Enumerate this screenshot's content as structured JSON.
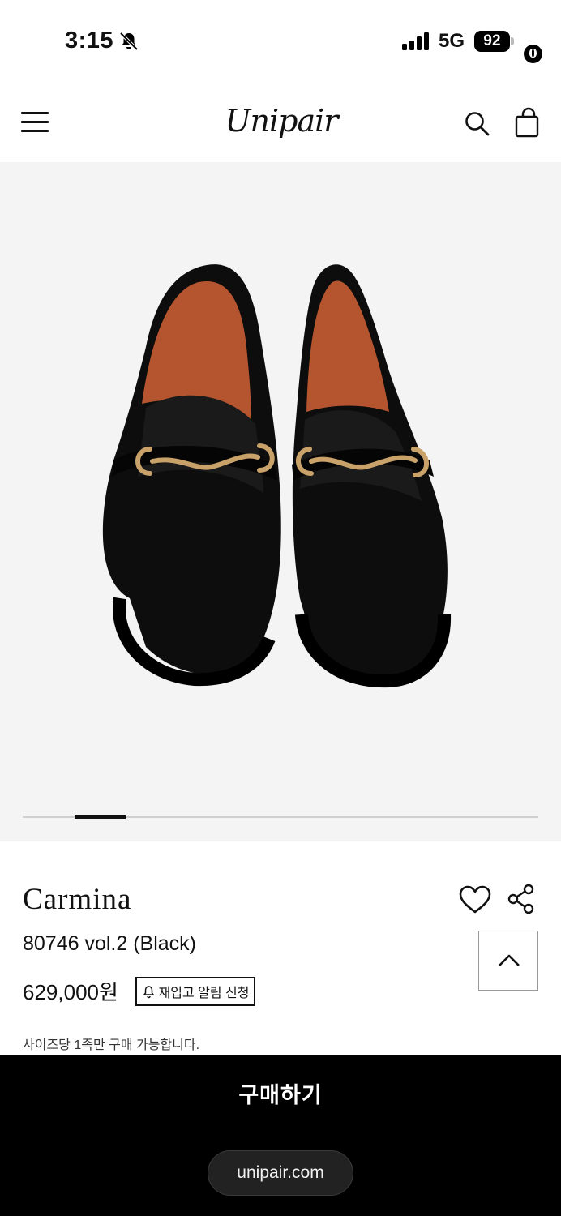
{
  "status_bar": {
    "time": "3:15",
    "network": "5G",
    "battery": "92"
  },
  "header": {
    "logo": "Unipair",
    "cart_count": "0"
  },
  "gallery": {
    "image_alt": "Carmina black leather horsebit loafers",
    "slide_progress": 0.11
  },
  "product": {
    "brand": "Carmina",
    "name": "80746 vol.2 (Black)",
    "price": "629,000원",
    "restock_label": "재입고 알림 신청",
    "notice": "사이즈당 1족만 구매 가능합니다."
  },
  "actions": {
    "buy_label": "구매하기",
    "url": "unipair.com"
  },
  "colors": {
    "background": "#ffffff",
    "gallery_bg": "#f4f4f4",
    "buy_bar": "#000000",
    "hardware_gold": "#c9a26a",
    "lining_tan": "#b5552f"
  }
}
